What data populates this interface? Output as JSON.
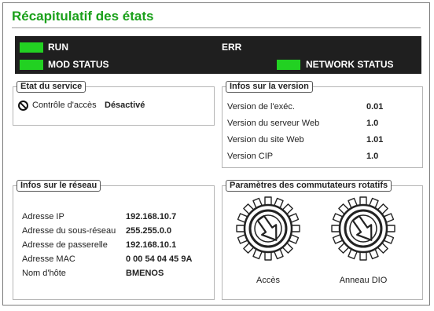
{
  "page": {
    "title": "Récapitulatif des états"
  },
  "status": {
    "run": "RUN",
    "err": "ERR",
    "mod_status": "MOD STATUS",
    "network_status": "NETWORK STATUS",
    "led_color": "#22d122",
    "bar_color": "#1f1f1f"
  },
  "service": {
    "title": "Etat du service",
    "access_label": "Contrôle d'accès",
    "access_value": "Désactivé"
  },
  "version": {
    "title": "Infos sur la version",
    "rows": [
      {
        "label": "Version de l'exéc.",
        "value": "0.01"
      },
      {
        "label": "Version du serveur Web",
        "value": "1.0"
      },
      {
        "label": "Version du site Web",
        "value": "1.01"
      },
      {
        "label": "Version CIP",
        "value": "1.0"
      }
    ]
  },
  "network": {
    "title": "Infos sur le réseau",
    "rows": [
      {
        "label": "Adresse IP",
        "value": "192.168.10.7"
      },
      {
        "label": "Adresse du sous-réseau",
        "value": "255.255.0.0"
      },
      {
        "label": "Adresse de passerelle",
        "value": "192.168.10.1"
      },
      {
        "label": "Adresse MAC",
        "value": "0 00 54 04 45 9A"
      },
      {
        "label": "Nom d'hôte",
        "value": "BMENOS"
      }
    ]
  },
  "switches": {
    "title": "Paramètres des commutateurs rotatifs",
    "items": [
      {
        "label": "Accès",
        "icon": "rotary-switch-icon"
      },
      {
        "label": "Anneau DIO",
        "icon": "rotary-switch-icon"
      }
    ]
  },
  "colors": {
    "title_green": "#1aa01a"
  }
}
